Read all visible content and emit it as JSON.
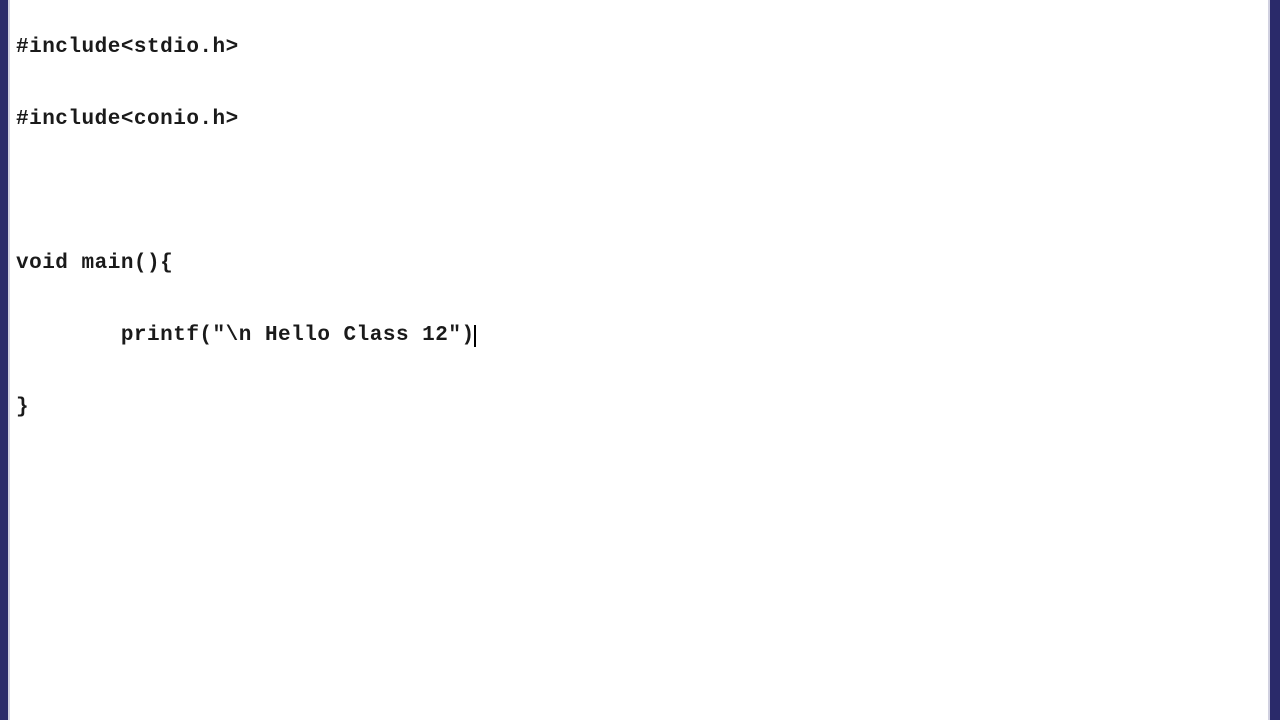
{
  "code": {
    "line1": "#include<stdio.h>",
    "line2": "#include<conio.h>",
    "line3": "",
    "line4": "void main(){",
    "line5": "        printf(\"\\n Hello Class 12\")",
    "line6": "}"
  }
}
